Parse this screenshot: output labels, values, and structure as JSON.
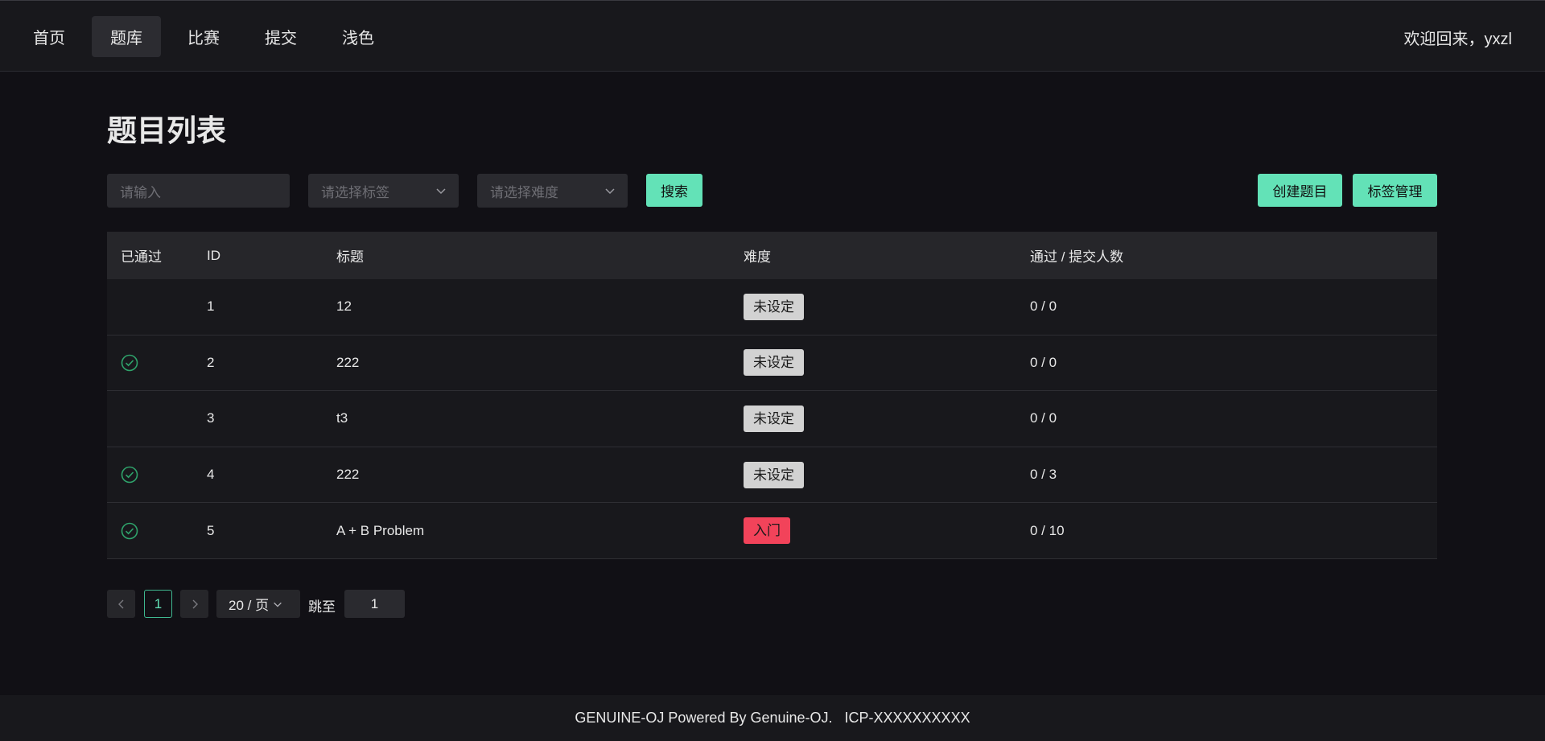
{
  "nav": {
    "items": [
      {
        "label": "首页"
      },
      {
        "label": "题库"
      },
      {
        "label": "比赛"
      },
      {
        "label": "提交"
      },
      {
        "label": "浅色"
      }
    ],
    "active_index": 1,
    "welcome": "欢迎回来，yxzl"
  },
  "page": {
    "title": "题目列表"
  },
  "filters": {
    "search_placeholder": "请输入",
    "tag_placeholder": "请选择标签",
    "difficulty_placeholder": "请选择难度",
    "search_button": "搜索",
    "create_button": "创建题目",
    "tags_button": "标签管理"
  },
  "table": {
    "headers": [
      "已通过",
      "ID",
      "标题",
      "难度",
      "通过 / 提交人数"
    ],
    "rows": [
      {
        "passed": false,
        "id": "1",
        "title": "12",
        "difficulty": "未设定",
        "difficulty_kind": "unset",
        "stats": "0 / 0"
      },
      {
        "passed": true,
        "id": "2",
        "title": "222",
        "difficulty": "未设定",
        "difficulty_kind": "unset",
        "stats": "0 / 0"
      },
      {
        "passed": false,
        "id": "3",
        "title": "t3",
        "difficulty": "未设定",
        "difficulty_kind": "unset",
        "stats": "0 / 0"
      },
      {
        "passed": true,
        "id": "4",
        "title": "222",
        "difficulty": "未设定",
        "difficulty_kind": "unset",
        "stats": "0 / 3"
      },
      {
        "passed": true,
        "id": "5",
        "title": "A + B Problem",
        "difficulty": "入门",
        "difficulty_kind": "intro",
        "stats": "0 / 10"
      }
    ]
  },
  "pagination": {
    "current_page": "1",
    "page_size": "20 / 页",
    "jump_label": "跳至",
    "jump_value": "1"
  },
  "footer": {
    "text": "GENUINE-OJ Powered By Genuine-OJ.   ICP-XXXXXXXXXX"
  },
  "colors": {
    "accent": "#63e2b7",
    "success_icon": "#2fa36b",
    "difficulty_unset": "#d2d2d2",
    "difficulty_intro": "#f2435a"
  }
}
